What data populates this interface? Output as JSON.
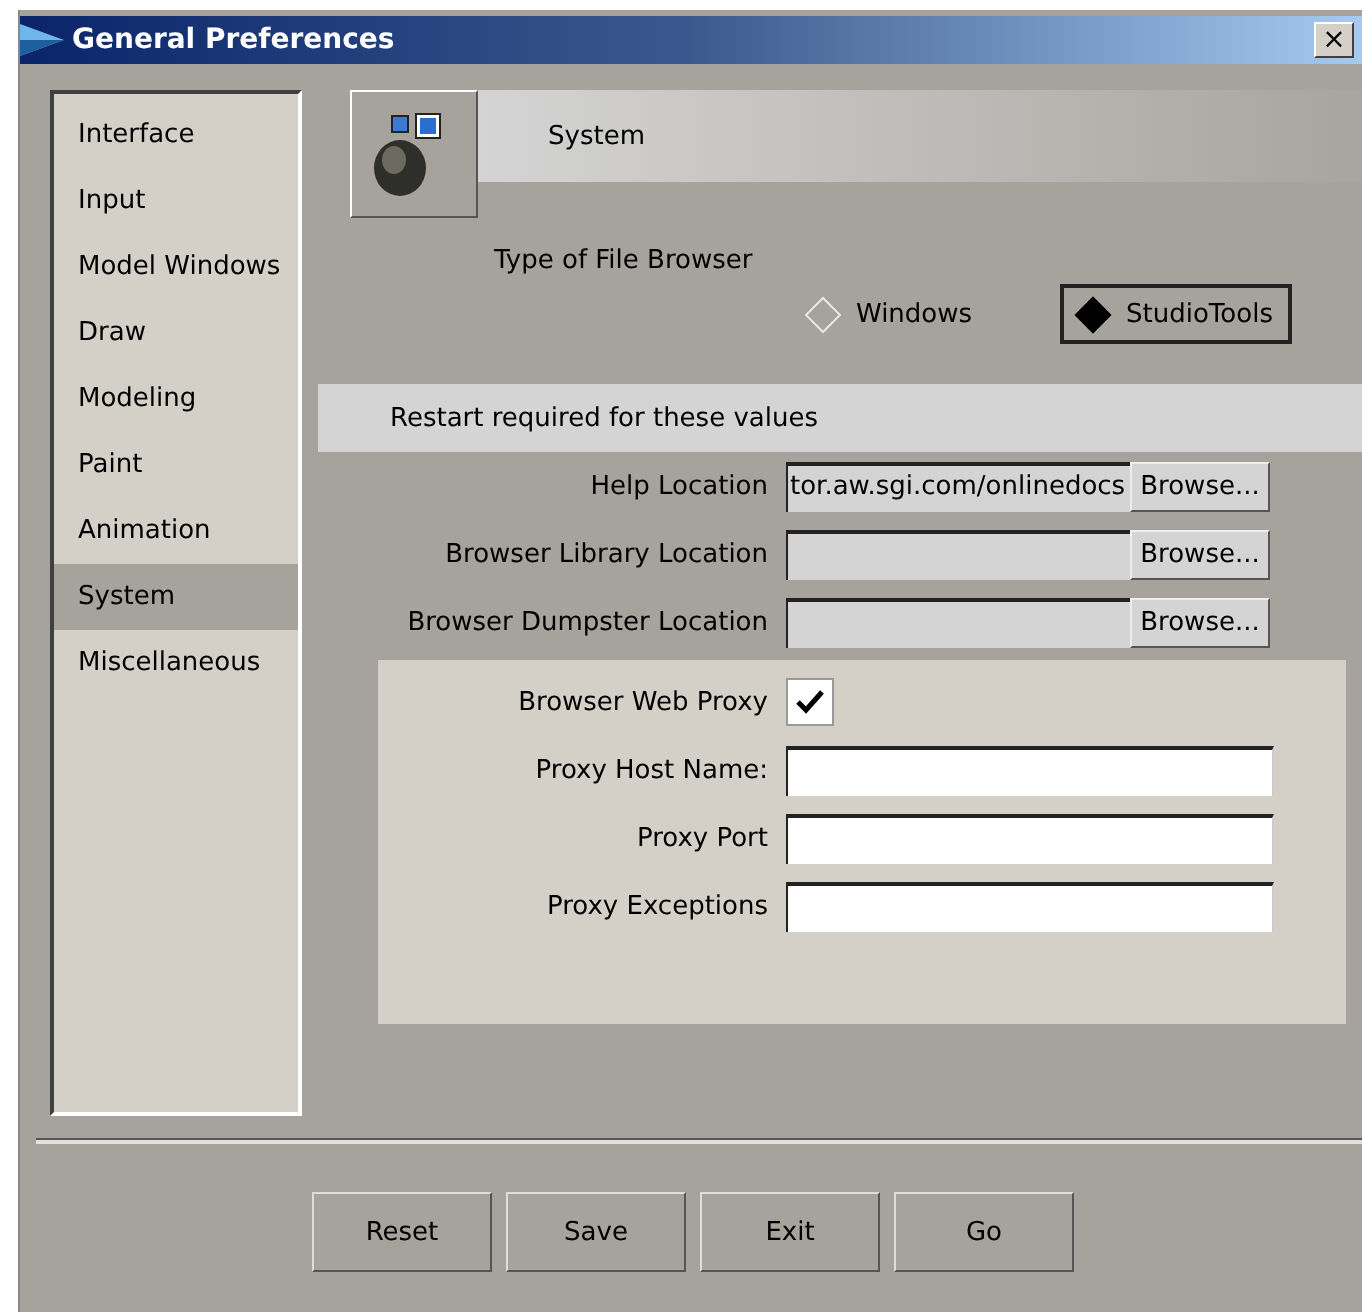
{
  "window": {
    "title": "General Preferences",
    "close": "×"
  },
  "sidebar": {
    "items": [
      {
        "label": "Interface",
        "selected": false
      },
      {
        "label": "Input",
        "selected": false
      },
      {
        "label": "Model Windows",
        "selected": false
      },
      {
        "label": "Draw",
        "selected": false
      },
      {
        "label": "Modeling",
        "selected": false
      },
      {
        "label": "Paint",
        "selected": false
      },
      {
        "label": "Animation",
        "selected": false
      },
      {
        "label": "System",
        "selected": true
      },
      {
        "label": "Miscellaneous",
        "selected": false
      }
    ]
  },
  "header": {
    "title": "System"
  },
  "file_browser": {
    "label": "Type of File Browser",
    "options": [
      {
        "label": "Windows",
        "selected": false
      },
      {
        "label": "StudioTools",
        "selected": true
      }
    ]
  },
  "restart_section": {
    "title": "Restart required for these values",
    "rows": [
      {
        "label": "Help Location",
        "value": "tor.aw.sgi.com/onlinedocs",
        "button": "Browse..."
      },
      {
        "label": "Browser Library Location",
        "value": "",
        "button": "Browse..."
      },
      {
        "label": "Browser Dumpster Location",
        "value": "",
        "button": "Browse..."
      }
    ]
  },
  "proxy": {
    "enable": {
      "label": "Browser Web Proxy",
      "checked": true
    },
    "fields": [
      {
        "label": "Proxy Host Name:"
      },
      {
        "label": "Proxy Port"
      },
      {
        "label": "Proxy Exceptions"
      }
    ]
  },
  "buttons": [
    "Reset",
    "Save",
    "Exit",
    "Go"
  ]
}
